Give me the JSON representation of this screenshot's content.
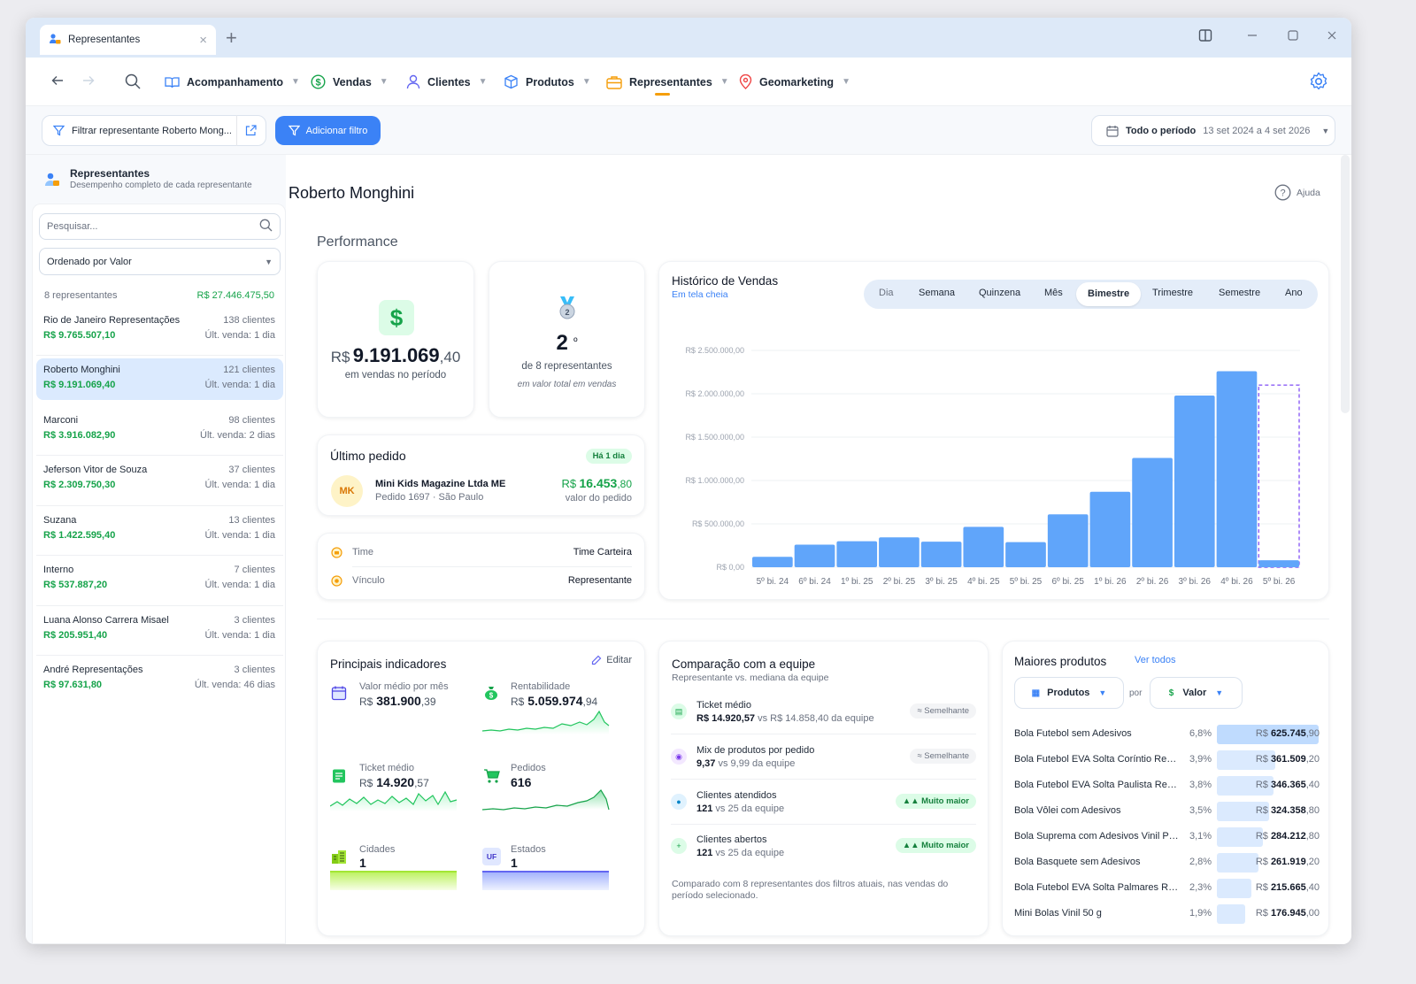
{
  "browser": {
    "tab_title": "Representantes"
  },
  "nav": {
    "items": [
      {
        "label": "Acompanhamento"
      },
      {
        "label": "Vendas"
      },
      {
        "label": "Clientes"
      },
      {
        "label": "Produtos"
      },
      {
        "label": "Representantes"
      },
      {
        "label": "Geomarketing"
      }
    ],
    "active": "Representantes"
  },
  "filters": {
    "chip_label": "Filtrar representante Roberto Mong...",
    "add_label": "Adicionar filtro",
    "period_label": "Todo o período",
    "period_range": "13 set 2024 a 4 set 2026"
  },
  "sidebar": {
    "title": "Representantes",
    "subtitle": "Desempenho completo de cada representante",
    "search_placeholder": "Pesquisar...",
    "sort_label": "Ordenado por Valor",
    "count_label": "8 representantes",
    "total_value": "R$ 27.446.475,50",
    "reps": [
      {
        "name": "Rio de Janeiro Representações",
        "value": "R$ 9.765.507,10",
        "clients": "138 clientes",
        "last_sale": "Últ. venda: 1 dia"
      },
      {
        "name": "Roberto Monghini",
        "value": "R$ 9.191.069,40",
        "clients": "121 clientes",
        "last_sale": "Últ. venda: 1 dia"
      },
      {
        "name": "Marconi",
        "value": "R$ 3.916.082,90",
        "clients": "98 clientes",
        "last_sale": "Últ. venda: 2 dias"
      },
      {
        "name": "Jeferson Vitor de Souza",
        "value": "R$ 2.309.750,30",
        "clients": "37 clientes",
        "last_sale": "Últ. venda: 1 dia"
      },
      {
        "name": "Suzana",
        "value": "R$ 1.422.595,40",
        "clients": "13 clientes",
        "last_sale": "Últ. venda: 1 dia"
      },
      {
        "name": "Interno",
        "value": "R$ 537.887,20",
        "clients": "7 clientes",
        "last_sale": "Últ. venda: 1 dia"
      },
      {
        "name": "Luana Alonso Carrera Misael",
        "value": "R$ 205.951,40",
        "clients": "3 clientes",
        "last_sale": "Últ. venda: 1 dia"
      },
      {
        "name": "André Representações",
        "value": "R$ 97.631,80",
        "clients": "3 clientes",
        "last_sale": "Últ. venda: 46 dias"
      }
    ]
  },
  "main": {
    "title": "Roberto Monghini",
    "help_label": "Ajuda",
    "section_title": "Performance",
    "sales": {
      "currency": "R$",
      "integer": "9.191.069",
      "cents": ",40",
      "caption": "em vendas no período"
    },
    "rank": {
      "position": "2",
      "ordinal": "º",
      "of_label": "de 8 representantes",
      "caption": "em valor total em vendas"
    },
    "last_order": {
      "title": "Último pedido",
      "badge": "Há 1 dia",
      "initials": "MK",
      "customer": "Mini Kids Magazine Ltda ME",
      "detail": "Pedido 1697 · São Paulo",
      "currency": "R$",
      "integer": "16.453",
      "cents": ",80",
      "caption": "valor do pedido"
    },
    "info": [
      {
        "label": "Time",
        "value": "Time Carteira"
      },
      {
        "label": "Vínculo",
        "value": "Representante"
      }
    ],
    "history": {
      "title": "Histórico de Vendas",
      "fullscreen": "Em tela cheia",
      "periods": [
        "Dia",
        "Semana",
        "Quinzena",
        "Mês",
        "Bimestre",
        "Trimestre",
        "Semestre",
        "Ano"
      ],
      "active_period": "Bimestre"
    },
    "indicators": {
      "title": "Principais indicadores",
      "edit_label": "Editar",
      "items": [
        {
          "label": "Valor médio por mês",
          "currency": "R$",
          "value": "381.900",
          "cents": ",39"
        },
        {
          "label": "Rentabilidade",
          "currency": "R$",
          "value": "5.059.974",
          "cents": ",94"
        },
        {
          "label": "Ticket médio",
          "currency": "R$",
          "value": "14.920",
          "cents": ",57"
        },
        {
          "label": "Pedidos",
          "value": "616"
        },
        {
          "label": "Cidades",
          "value": "1"
        },
        {
          "label": "Estados",
          "value": "1",
          "icon_text": "UF"
        }
      ]
    },
    "comparison": {
      "title": "Comparação com a equipe",
      "subtitle": "Representante vs. mediana da equipe",
      "rows": [
        {
          "label": "Ticket médio",
          "value": "R$ 14.920,57",
          "vs": "vs R$ 14.858,40 da equipe",
          "badge": "≈ Semelhante"
        },
        {
          "label": "Mix de produtos por pedido",
          "value": "9,37",
          "vs": "vs 9,99 da equipe",
          "badge": "≈ Semelhante"
        },
        {
          "label": "Clientes atendidos",
          "value": "121",
          "vs": "vs 25 da equipe",
          "badge": "▲▲ Muito maior"
        },
        {
          "label": "Clientes abertos",
          "value": "121",
          "vs": "vs 25 da equipe",
          "badge": "▲▲ Muito maior"
        }
      ],
      "footnote": "Comparado com 8 representantes dos filtros atuais, nas vendas do período selecionado."
    },
    "top_products": {
      "title": "Maiores produtos",
      "see_all": "Ver todos",
      "group_label": "Produtos",
      "by_label": "por",
      "metric_label": "Valor",
      "rows": [
        {
          "name": "Bola Futebol sem Adesivos",
          "pct": "6,8%",
          "share": 0.068,
          "currency": "R$",
          "value": "625.745",
          "cents": ",90"
        },
        {
          "name": "Bola Futebol EVA Solta Coríntio Rede...",
          "pct": "3,9%",
          "share": 0.039,
          "currency": "R$",
          "value": "361.509",
          "cents": ",20"
        },
        {
          "name": "Bola Futebol EVA Solta Paulista Rede...",
          "pct": "3,8%",
          "share": 0.038,
          "currency": "R$",
          "value": "346.365",
          "cents": ",40"
        },
        {
          "name": "Bola Vôlei com Adesivos",
          "pct": "3,5%",
          "share": 0.035,
          "currency": "R$",
          "value": "324.358",
          "cents": ",80"
        },
        {
          "name": "Bola Suprema com Adesivos Vinil Puro",
          "pct": "3,1%",
          "share": 0.031,
          "currency": "R$",
          "value": "284.212",
          "cents": ",80"
        },
        {
          "name": "Bola Basquete sem Adesivos",
          "pct": "2,8%",
          "share": 0.028,
          "currency": "R$",
          "value": "261.919",
          "cents": ",20"
        },
        {
          "name": "Bola Futebol EVA Solta Palmares Red...",
          "pct": "2,3%",
          "share": 0.023,
          "currency": "R$",
          "value": "215.665",
          "cents": ",40"
        },
        {
          "name": "Mini Bolas Vinil 50 g",
          "pct": "1,9%",
          "share": 0.019,
          "currency": "R$",
          "value": "176.945",
          "cents": ",00"
        }
      ]
    }
  },
  "colors": {
    "accent": "#3b82f6",
    "bar": "#60a5fa",
    "positive": "#16a34a",
    "active_nav": "#f59e0b",
    "partial_bar": "#8b5cf6"
  },
  "chart_data": {
    "type": "bar",
    "categories": [
      "5º bi. 24",
      "6º bi. 24",
      "1º bi. 25",
      "2º bi. 25",
      "3º bi. 25",
      "4º bi. 25",
      "5º bi. 25",
      "6º bi. 25",
      "1º bi. 26",
      "2º bi. 26",
      "3º bi. 26",
      "4º bi. 26",
      "5º bi. 26"
    ],
    "values": [
      120000,
      260000,
      300000,
      345000,
      295000,
      465000,
      290000,
      610000,
      870000,
      1260000,
      1980000,
      2260000,
      80000
    ],
    "partial_last": true,
    "yticks": [
      "R$ 0,00",
      "R$ 500.000,00",
      "R$ 1.000.000,00",
      "R$ 1.500.000,00",
      "R$ 2.000.000,00",
      "R$ 2.500.000,00"
    ],
    "ylim": [
      0,
      2500000
    ],
    "grid": true
  }
}
